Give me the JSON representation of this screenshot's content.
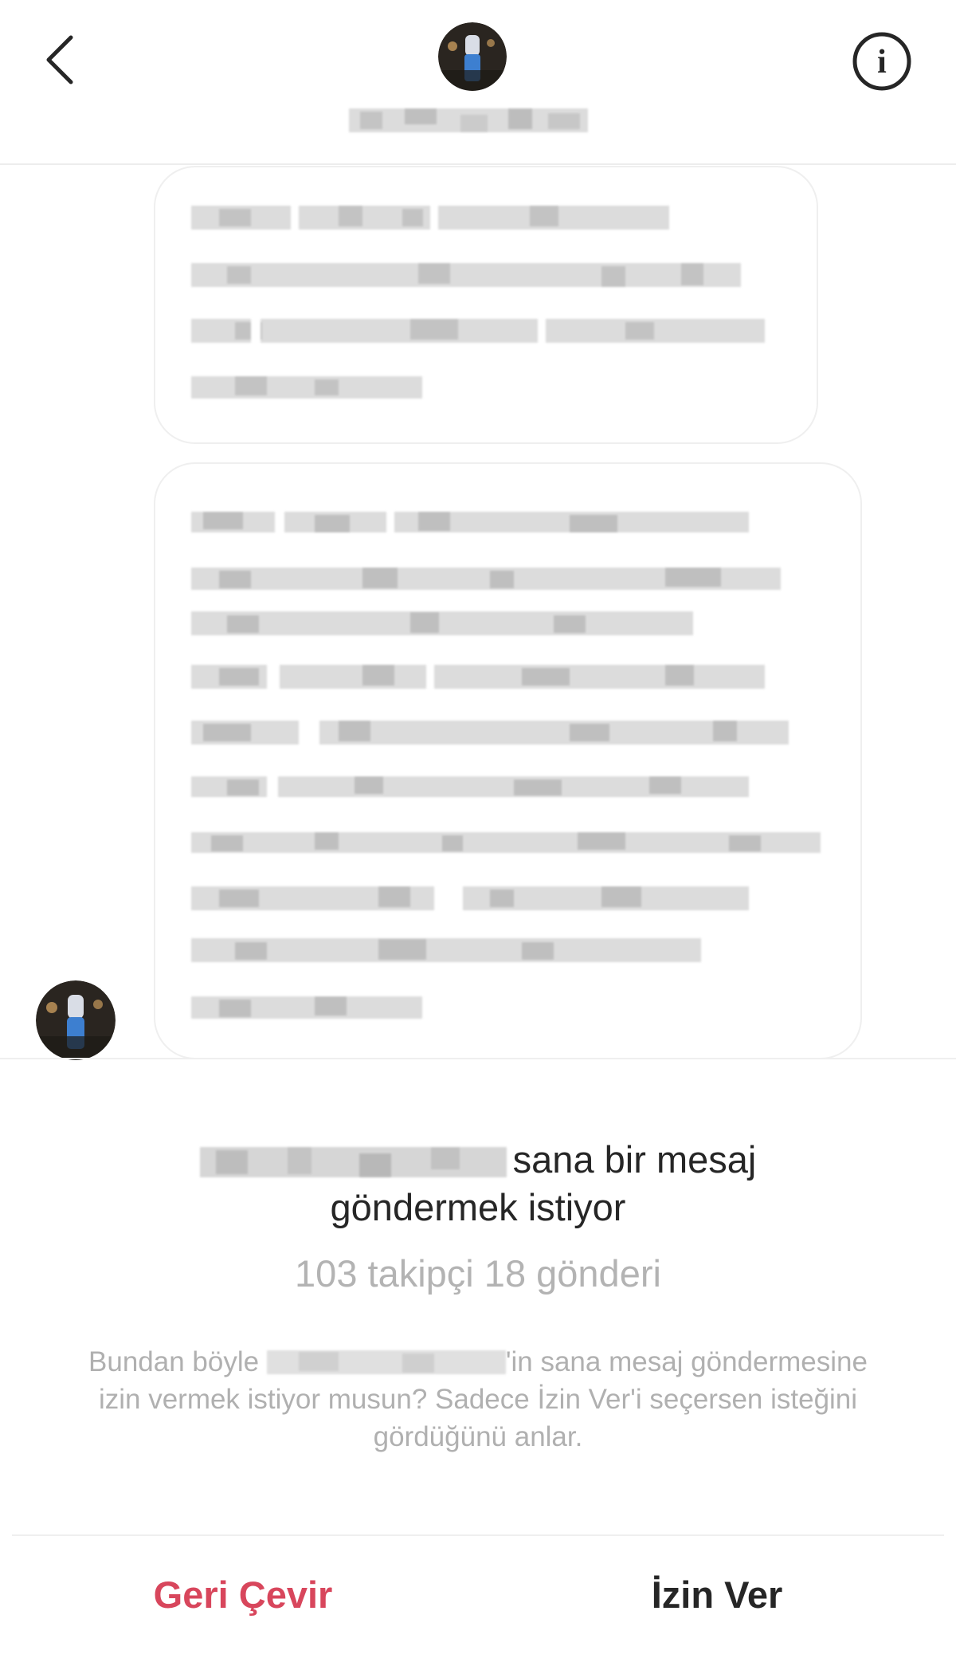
{
  "header": {
    "back_icon": "chevron-left-icon",
    "info_icon": "info-icon",
    "info_glyph": "i"
  },
  "request": {
    "message_line1": "sana bir mesaj",
    "message_line2": "göndermek istiyor",
    "stats": "103 takipçi 18 gönderi",
    "desc_part1": "Bundan böyle ",
    "desc_part2": "'in sana mesaj göndermesine izin vermek istiyor musun? Sadece İzin Ver'i seçersen isteğini gördüğünü anlar."
  },
  "actions": {
    "decline_label": "Geri Çevir",
    "allow_label": "İzin Ver"
  },
  "colors": {
    "decline": "#d8465c",
    "muted_text": "#b0b0b0",
    "primary_text": "#262626"
  }
}
